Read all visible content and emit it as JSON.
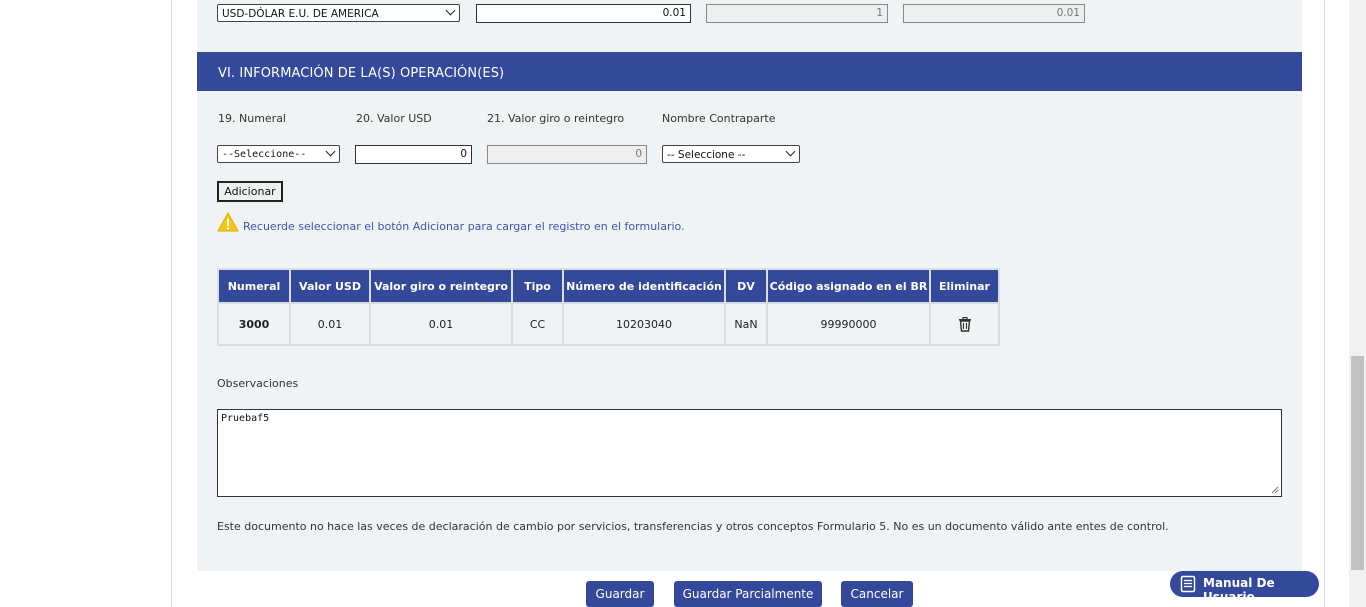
{
  "currency_row": {
    "currency_select": "USD-DÓLAR E.U. DE AMERICA",
    "amount_value": "0.01",
    "rate_value": "1",
    "usd_value": "0.01"
  },
  "section": {
    "title": "VI. INFORMACIÓN DE LA(S) OPERACIÓN(ES)"
  },
  "fields": {
    "numeral_label": "19. Numeral",
    "valor_usd_label": "20. Valor USD",
    "valor_giro_label": "21. Valor giro o reintegro",
    "contraparte_label": "Nombre Contraparte",
    "numeral_select": "--Seleccione--",
    "valor_usd_value": "0",
    "valor_giro_value": "0",
    "contraparte_select": "-- Seleccione --"
  },
  "add_button": "Adicionar",
  "warning": "Recuerde seleccionar el botón Adicionar para cargar el registro en el formulario.",
  "table": {
    "headers": [
      "Numeral",
      "Valor USD",
      "Valor giro o reintegro",
      "Tipo",
      "Número de identificación",
      "DV",
      "Código asignado en el BR",
      "Eliminar"
    ],
    "rows": [
      {
        "numeral": "3000",
        "valor_usd": "0.01",
        "valor_giro": "0.01",
        "tipo": "CC",
        "identificacion": "10203040",
        "dv": "NaN",
        "codigo": "99990000"
      }
    ]
  },
  "observaciones": {
    "label": "Observaciones",
    "value": "Pruebaf5"
  },
  "disclaimer": "Este documento no hace las veces de declaración de cambio por servicios, transferencias y otros conceptos Formulario 5. No es un documento válido ante entes de control.",
  "actions": {
    "save": "Guardar",
    "save_partial": "Guardar Parcialmente",
    "cancel": "Cancelar"
  },
  "manual_button": "Manual De Usuario",
  "colors": {
    "primary": "#34499a",
    "panel": "#f0f3f4",
    "warning_text": "#3d55b0",
    "warning_icon": "#f5c518"
  }
}
